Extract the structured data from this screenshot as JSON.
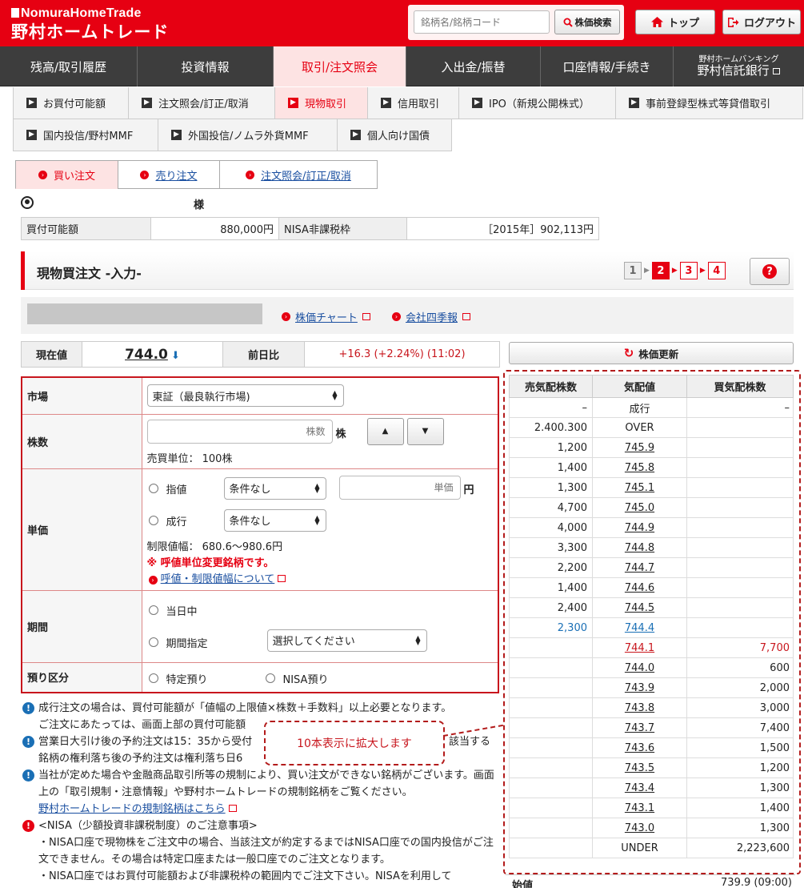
{
  "header": {
    "logo_en": "NomuraHomeTrade",
    "logo_ja": "野村ホームトレード",
    "search_placeholder": "銘柄名/銘柄コード",
    "search_button": "株価検索",
    "top_button": "トップ",
    "logout_button": "ログアウト"
  },
  "main_nav": [
    {
      "label": "残高/取引履歴"
    },
    {
      "label": "投資情報"
    },
    {
      "label": "取引/注文照会"
    },
    {
      "label": "入出金/振替"
    },
    {
      "label": "口座情報/手続き"
    }
  ],
  "bank": {
    "small": "野村ホームバンキング",
    "label": "野村信託銀行"
  },
  "sub_nav": [
    {
      "label": "お買付可能額"
    },
    {
      "label": "注文照会/訂正/取消"
    },
    {
      "label": "現物取引"
    },
    {
      "label": "信用取引"
    },
    {
      "label": "IPO（新規公開株式）"
    },
    {
      "label": "事前登録型株式等貸借取引"
    },
    {
      "label": "国内投信/野村MMF"
    },
    {
      "label": "外国投信/ノムラ外貨MMF"
    },
    {
      "label": "個人向け国債"
    }
  ],
  "order_tabs": [
    {
      "label": "買い注文"
    },
    {
      "label": "売り注文"
    },
    {
      "label": "注文照会/訂正/取消"
    }
  ],
  "account": {
    "sama": "様",
    "buy_power_label": "買付可能額",
    "buy_power_value": "880,000円",
    "nisa_label": "NISA非課税枠",
    "nisa_value": "［2015年］902,113円"
  },
  "section": {
    "title": "現物買注文 -入力-",
    "steps": [
      "1",
      "2",
      "3",
      "4"
    ],
    "help": "?"
  },
  "stock_links": {
    "chart": "株価チャート",
    "report": "会社四季報"
  },
  "price": {
    "current_label": "現在値",
    "current_value": "744.0",
    "change_label": "前日比",
    "change_value": "+16.3 (+2.24%) (11:02)",
    "refresh_button": "株価更新"
  },
  "form": {
    "market_label": "市場",
    "market_value": "東証（最良執行市場)",
    "qty_label": "株数",
    "qty_placeholder": "株数",
    "qty_unit": "株",
    "trade_unit": "売買単位： 100株",
    "price_label": "単価",
    "limit_label": "指値",
    "limit_cond": "条件なし",
    "price_placeholder": "単価",
    "price_unit": "円",
    "market_order_label": "成行",
    "market_cond": "条件なし",
    "limit_range": "制限値幅： 680.6〜980.6円",
    "tick_warning": "※ 呼値単位変更銘柄です。",
    "tick_link": "呼値・制限値幅について",
    "period_label": "期間",
    "today_label": "当日中",
    "period_specify_label": "期間指定",
    "period_select": "選択してください",
    "custody_label": "預り区分",
    "tokutei_label": "特定預り",
    "nisa_custody_label": "NISA預り"
  },
  "notes": [
    "成行注文の場合は、買付可能額が「値幅の上限値×株数＋手数料」以上必要となります。",
    "ご注文にあたっては、画面上部の買付可能額",
    "営業日大引け後の予約注文は15：35から受付",
    "該当する",
    "銘柄の権利落ち後の予約注文は権利落ち日6",
    "当社が定めた場合や金融商品取引所等の規制により、買い注文ができない銘柄がございます。画面上の「取引規制・注意情報」や野村ホームトレードの規制銘柄をご覧ください。",
    "野村ホームトレードの規制銘柄はこちら",
    "<NISA（少額投資非課税制度）のご注意事項>",
    "・NISA口座で現物株をご注文中の場合、当該注文が約定するまではNISA口座での国内投信がご注文できません。その場合は特定口座または一般口座でのご注文となります。",
    "・NISA口座ではお買付可能額および非課税枠の範囲内でご注文下さい。NISAを利用して"
  ],
  "callout": "10本表示に拡大します",
  "order_book": {
    "headers": [
      "売気配株数",
      "気配値",
      "買気配株数"
    ],
    "rows": [
      {
        "sell": "–",
        "price": "成行",
        "buy": "–"
      },
      {
        "sell": "2.400.300",
        "price": "OVER",
        "buy": ""
      },
      {
        "sell": "1,200",
        "price": "745.9",
        "buy": ""
      },
      {
        "sell": "1,400",
        "price": "745.8",
        "buy": ""
      },
      {
        "sell": "1,300",
        "price": "745.1",
        "buy": ""
      },
      {
        "sell": "4,700",
        "price": "745.0",
        "buy": ""
      },
      {
        "sell": "4,000",
        "price": "744.9",
        "buy": ""
      },
      {
        "sell": "3,300",
        "price": "744.8",
        "buy": ""
      },
      {
        "sell": "2,200",
        "price": "744.7",
        "buy": ""
      },
      {
        "sell": "1,400",
        "price": "744.6",
        "buy": ""
      },
      {
        "sell": "2,400",
        "price": "744.5",
        "buy": ""
      },
      {
        "sell": "2,300",
        "price": "744.4",
        "buy": ""
      },
      {
        "sell": "",
        "price": "744.1",
        "buy": "7,700"
      },
      {
        "sell": "",
        "price": "744.0",
        "buy": "600"
      },
      {
        "sell": "",
        "price": "743.9",
        "buy": "2,000"
      },
      {
        "sell": "",
        "price": "743.8",
        "buy": "3,000"
      },
      {
        "sell": "",
        "price": "743.7",
        "buy": "7,400"
      },
      {
        "sell": "",
        "price": "743.6",
        "buy": "1,500"
      },
      {
        "sell": "",
        "price": "743.5",
        "buy": "1,200"
      },
      {
        "sell": "",
        "price": "743.4",
        "buy": "1,300"
      },
      {
        "sell": "",
        "price": "743.1",
        "buy": "1,400"
      },
      {
        "sell": "",
        "price": "743.0",
        "buy": "1,300"
      },
      {
        "sell": "",
        "price": "UNDER",
        "buy": "2,223,600"
      }
    ],
    "open_label": "始値",
    "open_value": "739.9 (09:00)"
  },
  "colors": {
    "brand": "#e60012",
    "nav_dark": "#3d3d3d",
    "link": "#1a4fa0"
  }
}
